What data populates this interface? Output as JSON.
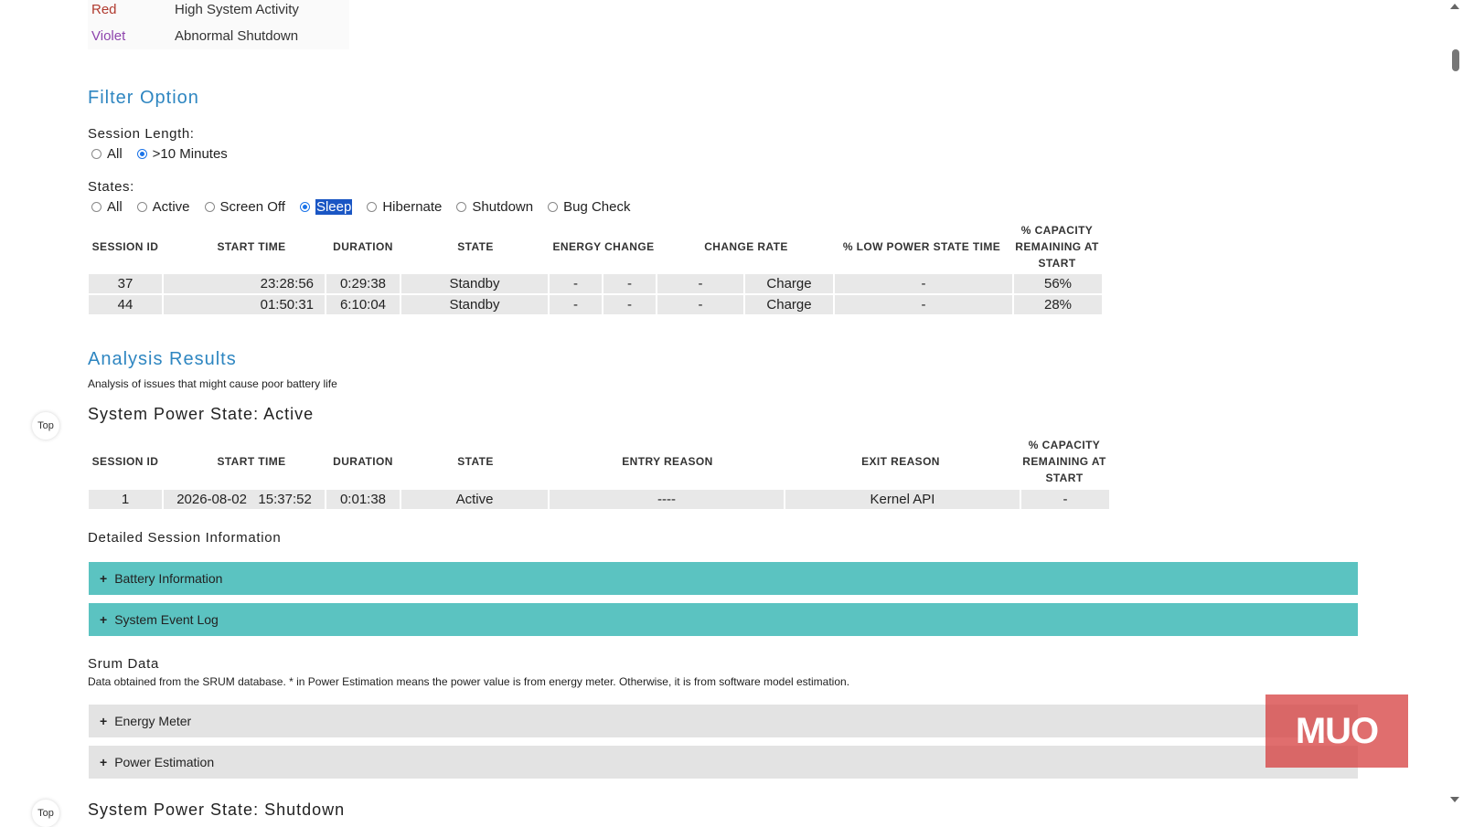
{
  "legend": [
    {
      "color": "Red",
      "desc": "High System Activity",
      "hex": "#c0392b"
    },
    {
      "color": "Violet",
      "desc": "Abnormal Shutdown",
      "hex": "#8e44ad"
    }
  ],
  "filter": {
    "title": "Filter Option",
    "session_length_label": "Session Length:",
    "session_length_options": [
      "All",
      ">10 Minutes"
    ],
    "session_length_selected": ">10 Minutes",
    "states_label": "States:",
    "states_options": [
      "All",
      "Active",
      "Screen Off",
      "Sleep",
      "Hibernate",
      "Shutdown",
      "Bug Check"
    ],
    "states_selected": "Sleep"
  },
  "sleep_table": {
    "headers": [
      "SESSION ID",
      "START TIME",
      "DURATION",
      "STATE",
      "ENERGY CHANGE",
      "CHANGE RATE",
      "% LOW POWER STATE TIME",
      "% CAPACITY REMAINING AT START"
    ],
    "rows": [
      [
        "37",
        "23:28:56",
        "0:29:38",
        "Standby",
        "-",
        "-",
        "-",
        "Charge",
        "-",
        "56%"
      ],
      [
        "44",
        "01:50:31",
        "6:10:04",
        "Standby",
        "-",
        "-",
        "-",
        "Charge",
        "-",
        "28%"
      ]
    ]
  },
  "analysis": {
    "title": "Analysis Results",
    "subtitle": "Analysis of issues that might cause poor battery life",
    "section_title": "System Power State: Active",
    "headers": [
      "SESSION ID",
      "START TIME",
      "DURATION",
      "STATE",
      "ENTRY REASON",
      "EXIT REASON",
      "% CAPACITY REMAINING AT START"
    ],
    "rows": [
      [
        "1",
        "2026-08-02   15:37:52",
        "0:01:38",
        "Active",
        "----",
        "Kernel API",
        "-"
      ]
    ],
    "detailed_title": "Detailed Session Information",
    "bars": [
      "Battery Information",
      "System Event Log"
    ],
    "srum_title": "Srum Data",
    "srum_desc": "Data obtained from the SRUM database. * in Power Estimation means the power value is from energy meter. Otherwise, it is from software model estimation.",
    "srum_bars": [
      "Energy Meter",
      "Power Estimation"
    ],
    "next_section": "System Power State: Shutdown"
  },
  "top_button": "Top",
  "plus": "+",
  "watermark": "MUO",
  "accent": "#2e86c1",
  "teal": "#5bc3c1"
}
